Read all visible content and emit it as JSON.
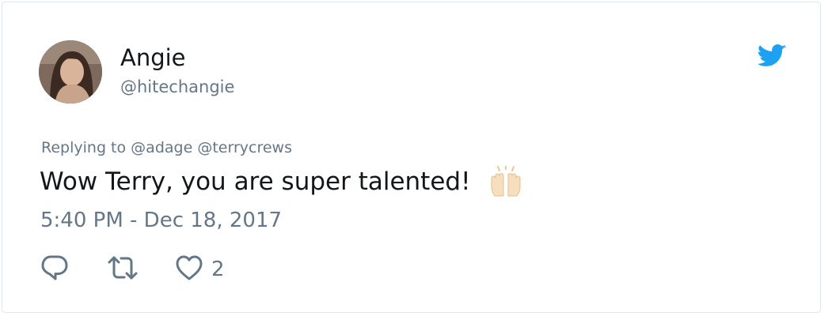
{
  "tweet": {
    "author": {
      "display_name": "Angie",
      "handle": "@hitechangie"
    },
    "replying_to": {
      "prefix": "Replying to",
      "mentions": [
        "@adage",
        "@terrycrews"
      ]
    },
    "text": "Wow Terry, you are super talented!",
    "emoji": "raising-hands-emoji",
    "timestamp": "5:40 PM - Dec 18, 2017",
    "actions": {
      "reply_icon": "reply-icon",
      "retweet_icon": "retweet-icon",
      "like_icon": "heart-icon",
      "like_count": "2"
    }
  },
  "colors": {
    "text_primary": "#14171a",
    "text_secondary": "#657786",
    "twitter_blue": "#1da1f2",
    "border": "#e1e8ed"
  }
}
